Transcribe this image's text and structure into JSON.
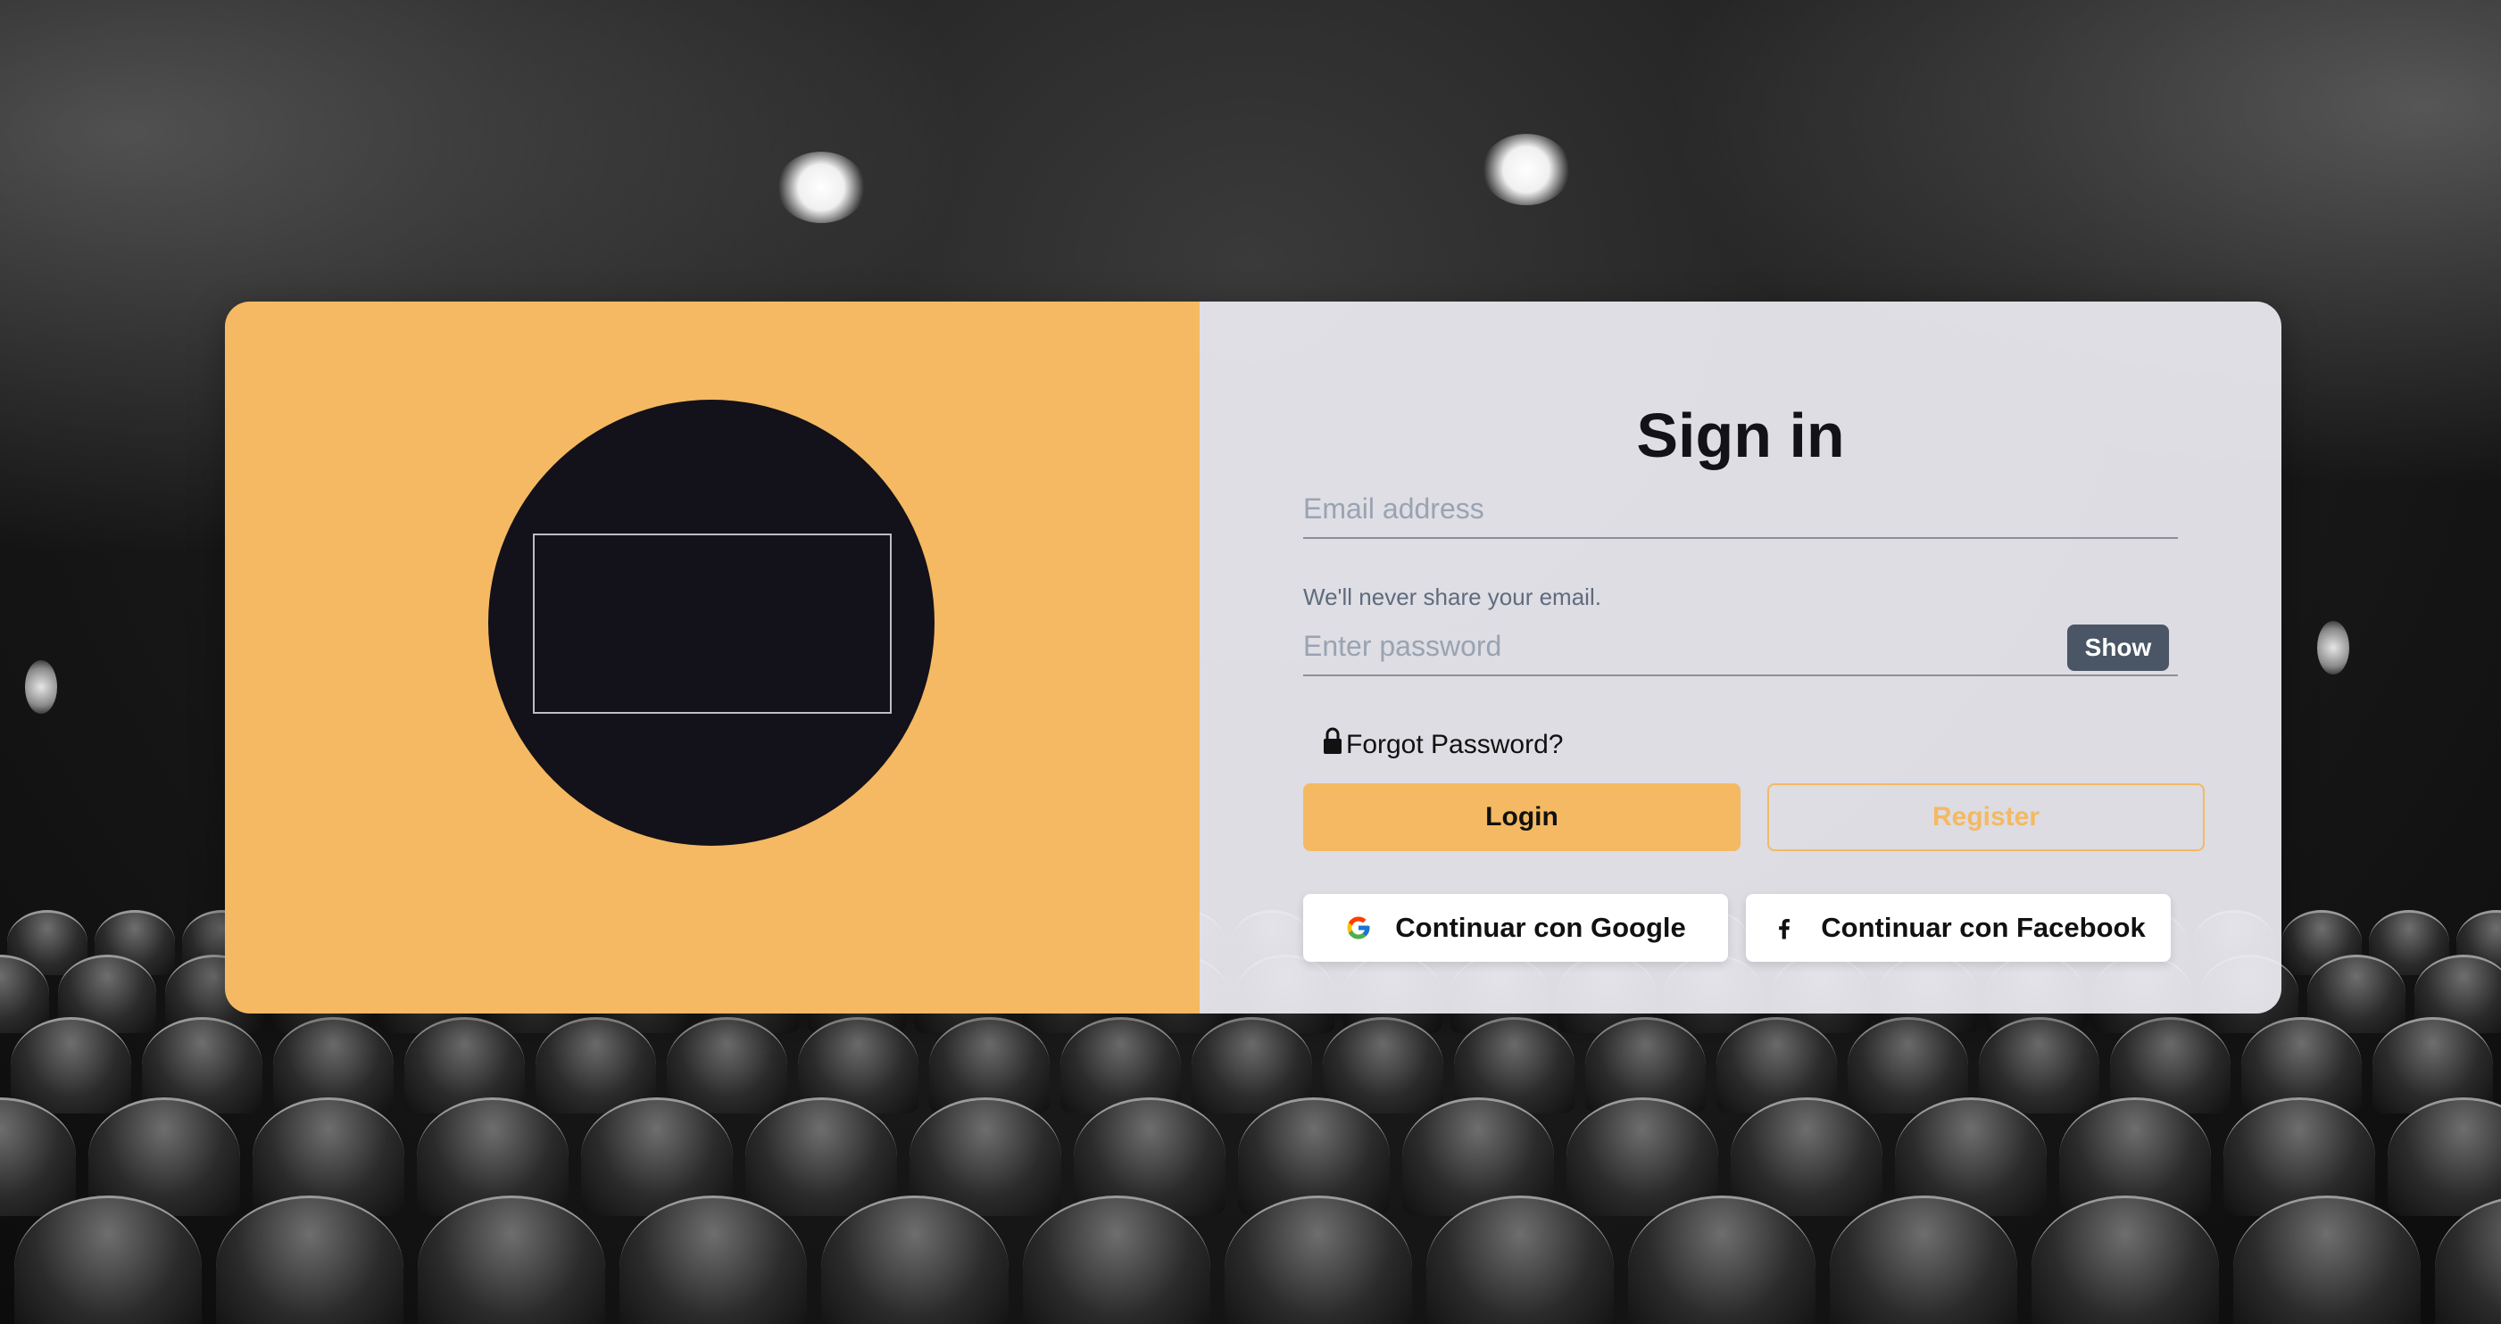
{
  "signin": {
    "title": "Sign in",
    "email_placeholder": "Email address",
    "email_hint": "We'll never share your email.",
    "password_placeholder": "Enter password",
    "show_label": "Show",
    "forgot_label": "Forgot Password?",
    "login_label": "Login",
    "register_label": "Register",
    "google_label": "Continuar con Google",
    "facebook_label": "Continuar con Facebook"
  },
  "icons": {
    "lock": "lock-icon",
    "google": "google-icon",
    "facebook": "facebook-icon"
  },
  "colors": {
    "accent": "#f4b962",
    "dark": "#13111a",
    "show_button": "#4a5565",
    "panel": "#ececf2"
  }
}
